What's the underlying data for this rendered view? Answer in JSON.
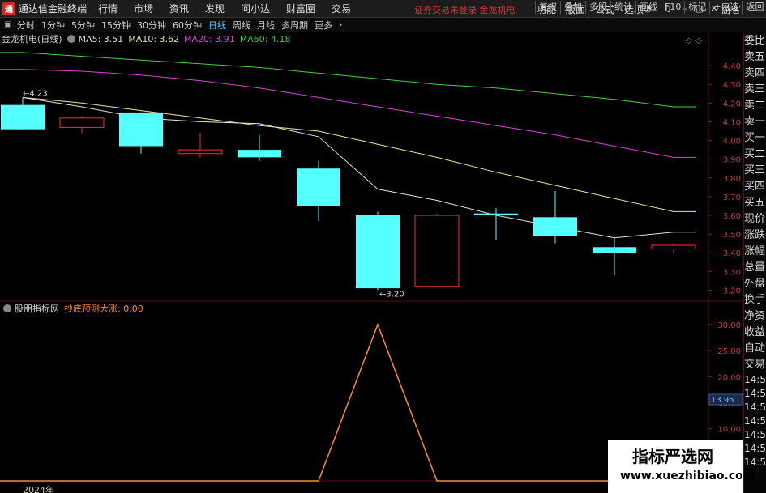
{
  "app": {
    "logo": "通",
    "title": "通达信金融终端",
    "user": "游客"
  },
  "menu": [
    "行情",
    "市场",
    "资讯",
    "发现",
    "问小达",
    "财富圈",
    "交易"
  ],
  "status_message": "证券交易未登录  金龙机电",
  "right_menu": [
    "功能",
    "版面",
    "公式",
    "选项"
  ],
  "periods": [
    "分时",
    "1分钟",
    "5分钟",
    "15分钟",
    "30分钟",
    "60分钟",
    "日线",
    "周线",
    "月线",
    "多周期",
    "更多"
  ],
  "active_period": "日线",
  "toolbar_right": [
    "复权",
    "叠加",
    "多股",
    "统计",
    "画线",
    "F10",
    "标记",
    "+自选",
    "返回"
  ],
  "main_header": {
    "stock": "金龙机电(日线)",
    "ma5": "MA5: 3.51",
    "ma10": "MA10: 3.62",
    "ma20": "MA20: 3.91",
    "ma60": "MA60: 4.18"
  },
  "indicator_header": {
    "name": "股朋指标网",
    "series": "抄底预测大涨: 0.00"
  },
  "right_panel_labels": [
    "委比",
    "卖五",
    "卖四",
    "卖三",
    "卖二",
    "卖一",
    "买一",
    "买二",
    "买三",
    "买四",
    "买五",
    "现价",
    "涨跌",
    "涨幅",
    "总量",
    "外盘",
    "换手",
    "净资",
    "收益",
    "自动",
    "交易"
  ],
  "right_panel_times": [
    "14:56",
    "14:56",
    "14:56",
    "14:56",
    "14:56",
    "14:56",
    "14:56"
  ],
  "current_value_badge": "13.95",
  "watermark": {
    "title": "指标严选网",
    "url": "www.xuezhibiao.com"
  },
  "bottom_date": "2024年",
  "colors": {
    "up": "#ff3030",
    "down": "#54ffff",
    "ma5": "#e0e0e0",
    "ma10": "#e8e89a",
    "ma20": "#e040e0",
    "ma60": "#40d040",
    "indicator": "#ff8c2a",
    "frame": "#5a1010"
  },
  "chart_data": [
    {
      "type": "candlestick",
      "title": "金龙机电(日线)",
      "ylim": [
        3.15,
        4.5
      ],
      "y_ticks": [
        4.4,
        4.3,
        4.2,
        4.1,
        4.0,
        3.9,
        3.8,
        3.7,
        3.6,
        3.5,
        3.4,
        3.3,
        3.2
      ],
      "y_tick_labels": [
        "4.40",
        "4.30",
        "4.20",
        "4.10",
        "4.00",
        "3.90",
        "3.80",
        "3.70",
        "3.60",
        "3.50",
        "3.40",
        "3.30",
        "3.20"
      ],
      "candles": [
        {
          "open": 4.19,
          "high": 4.23,
          "low": 4.06,
          "close": 4.06
        },
        {
          "open": 4.07,
          "high": 4.13,
          "low": 4.04,
          "close": 4.12
        },
        {
          "open": 4.15,
          "high": 4.15,
          "low": 3.93,
          "close": 3.97
        },
        {
          "open": 3.93,
          "high": 4.04,
          "low": 3.91,
          "close": 3.95
        },
        {
          "open": 3.95,
          "high": 4.03,
          "low": 3.89,
          "close": 3.91
        },
        {
          "open": 3.85,
          "high": 3.89,
          "low": 3.57,
          "close": 3.65
        },
        {
          "open": 3.6,
          "high": 3.62,
          "low": 3.2,
          "close": 3.21
        },
        {
          "open": 3.22,
          "high": 3.61,
          "low": 3.22,
          "close": 3.6
        },
        {
          "open": 3.61,
          "high": 3.64,
          "low": 3.47,
          "close": 3.6
        },
        {
          "open": 3.59,
          "high": 3.73,
          "low": 3.45,
          "close": 3.49
        },
        {
          "open": 3.43,
          "high": 3.48,
          "low": 3.28,
          "close": 3.4
        },
        {
          "open": 3.42,
          "high": 3.45,
          "low": 3.4,
          "close": 3.44
        }
      ],
      "ma5": [
        4.23,
        4.18,
        4.12,
        4.1,
        4.09,
        4.02,
        3.74,
        3.68,
        3.6,
        3.54,
        3.48,
        3.51
      ],
      "ma10": [
        4.23,
        4.2,
        4.16,
        4.12,
        4.08,
        4.05,
        3.98,
        3.91,
        3.83,
        3.76,
        3.69,
        3.62
      ],
      "ma20": [
        4.38,
        4.37,
        4.35,
        4.32,
        4.28,
        4.23,
        4.18,
        4.13,
        4.08,
        4.03,
        3.97,
        3.91
      ],
      "ma60": [
        4.47,
        4.45,
        4.43,
        4.41,
        4.39,
        4.36,
        4.33,
        4.3,
        4.28,
        4.25,
        4.22,
        4.18
      ],
      "annotations": [
        {
          "text": "←3.20",
          "candle": 6,
          "value": 3.2
        },
        {
          "text": "←4.23",
          "candle": 0,
          "value": 4.23
        }
      ]
    },
    {
      "type": "line",
      "series": [
        {
          "name": "抄底预测大涨",
          "values": [
            0,
            0,
            0,
            0,
            0,
            0,
            30,
            0,
            0,
            0,
            0,
            0
          ]
        }
      ],
      "ylim": [
        0,
        32
      ],
      "y_ticks": [
        30,
        25,
        20,
        15,
        10
      ],
      "y_tick_labels": [
        "30.00",
        "25.00",
        "20.00",
        "15.00",
        "10.00"
      ]
    }
  ]
}
